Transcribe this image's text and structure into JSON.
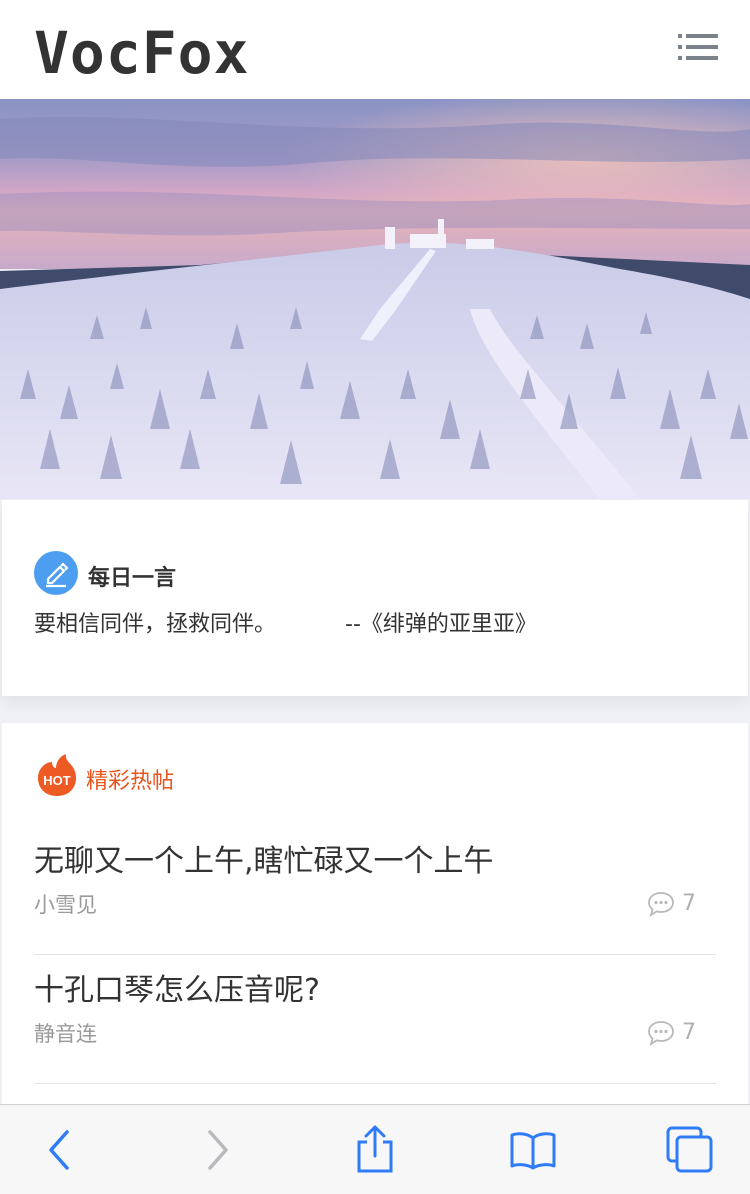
{
  "header": {
    "logo": "VocFox",
    "menu_icon": "list-menu-icon"
  },
  "hero": {
    "description_icon": "snowy-landscape-image"
  },
  "quote": {
    "icon": "pencil-icon",
    "title": "每日一言",
    "text": "要相信同伴，拯救同伴。",
    "source": "--《绯弹的亚里亚》"
  },
  "hot": {
    "icon": "hot-flame-icon",
    "icon_label": "HOT",
    "title": "精彩热帖",
    "posts": [
      {
        "title": "无聊又一个上午,瞎忙碌又一个上午",
        "author": "小雪见",
        "comments": "7"
      },
      {
        "title": "十孔口琴怎么压音呢?",
        "author": "静音连",
        "comments": "7"
      }
    ]
  },
  "colors": {
    "accent_blue": "#4d9ef0",
    "hot_orange": "#e8541e",
    "browser_blue": "#2f7cf6"
  },
  "browser_toolbar": {
    "buttons": [
      "back-icon",
      "forward-icon",
      "share-icon",
      "bookmarks-icon",
      "tabs-icon"
    ]
  }
}
